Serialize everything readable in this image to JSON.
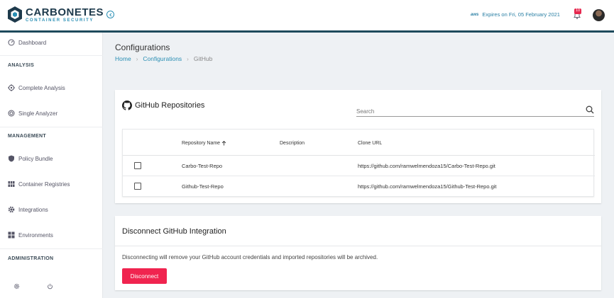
{
  "header": {
    "logo_main": "CARBONETES",
    "logo_sub": "CONTAINER SECURITY",
    "aws_label": "aws",
    "expires_text": "Expires on Fri, 05 February 2021",
    "notification_count": "10",
    "icons": [
      "carbonetes-logo-icon",
      "collapse-left-icon",
      "bell-icon",
      "avatar"
    ],
    "accent_color": "#1e4a5c"
  },
  "sidebar": {
    "dashboard": "Dashboard",
    "analysis_heading": "ANALYSIS",
    "complete_analysis": "Complete Analysis",
    "single_analyzer": "Single Analyzer",
    "management_heading": "MANAGEMENT",
    "policy_bundle": "Policy Bundle",
    "container_registries": "Container Registries",
    "integrations": "Integrations",
    "environments": "Environments",
    "administration_heading": "ADMINISTRATION",
    "footer_icons": [
      "settings-icon",
      "power-icon"
    ]
  },
  "page": {
    "title": "Configurations",
    "breadcrumb": [
      "Home",
      "Configurations",
      "GitHub"
    ]
  },
  "repositories": {
    "title": "GitHub Repositories",
    "search_placeholder": "Search",
    "columns": [
      "Repository Name",
      "Description",
      "Clone URL"
    ],
    "rows": [
      {
        "name": "Carbo-Test-Repo",
        "description": "",
        "clone_url": "https://github.com/ramwelmendoza15/Carbo-Test-Repo.git",
        "checked": false
      },
      {
        "name": "Github-Test-Repo",
        "description": "",
        "clone_url": "https://github.com/ramwelmendoza15/Github-Test-Repo.git",
        "checked": false
      }
    ]
  },
  "disconnect": {
    "title": "Disconnect GitHub Integration",
    "message": "Disconnecting will remove your GitHub account credentials and imported repositories will be archived.",
    "button_label": "Disconnect",
    "button_color": "#f0244f"
  }
}
